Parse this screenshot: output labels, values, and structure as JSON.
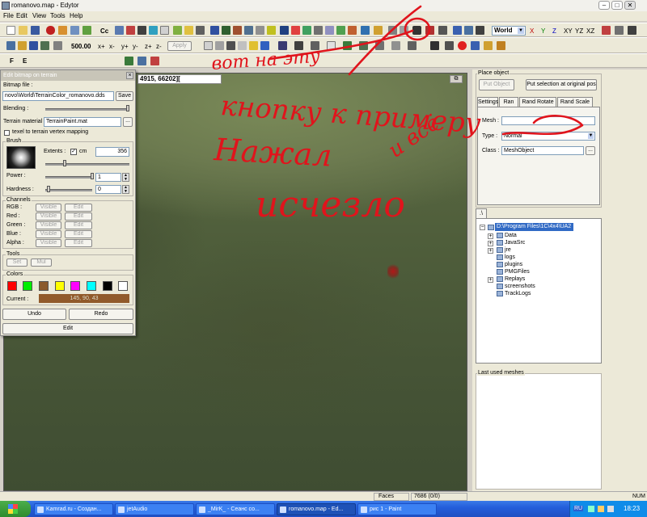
{
  "window": {
    "title": "romanovo.map - Edytor",
    "minimize": "–",
    "maximize": "□",
    "close": "✕"
  },
  "menu": [
    "File",
    "Edit",
    "View",
    "Tools",
    "Help"
  ],
  "toolbar1": {
    "cc_label": "Cc",
    "coord_system": "World",
    "axes": [
      "X",
      "Y",
      "Z",
      "XY",
      "YZ",
      "XZ"
    ]
  },
  "toolbar2": {
    "step_value": "500.00",
    "steps": [
      "x+",
      "x-",
      "y+",
      "y-",
      "z+",
      "z-"
    ],
    "apply_label": "Apply"
  },
  "toolbar3": {
    "f_label": "F",
    "e_label": "E"
  },
  "viewport": {
    "coords": "4915, 66202][",
    "corner_button": "⧉"
  },
  "dialog": {
    "title": "Edit bitmap on terrain",
    "bitmap_file_label": "Bitmap file :",
    "bitmap_file_value": "novo\\World\\TerrainColor_romanovo.dds",
    "save_label": "Save",
    "blending_label": "Blending :",
    "terrain_material_label": "Terrain material :",
    "terrain_material_value": "TerrainPaint.mat",
    "texel_label": "texel to terrain vertex mapping",
    "brush_label": "Brush",
    "extents_label": "Extents :",
    "cm_label": "cm",
    "extents_value": "356",
    "power_label": "Power :",
    "power_value": "1",
    "hardness_label": "Hardness :",
    "hardness_value": "0",
    "channels_label": "Channels",
    "channels": [
      {
        "name": "RGB :",
        "visible": "Visible",
        "edit": "Edit"
      },
      {
        "name": "Red :",
        "visible": "Visible",
        "edit": "Edit"
      },
      {
        "name": "Green :",
        "visible": "Visible",
        "edit": "Edit"
      },
      {
        "name": "Blue :",
        "visible": "Visible",
        "edit": "Edit"
      },
      {
        "name": "Alpha :",
        "visible": "Visible",
        "edit": "Edit"
      }
    ],
    "tools_label": "Tools",
    "set_label": "Set",
    "mul_label": "Mul",
    "colors_label": "Colors",
    "swatches": [
      "#ff0000",
      "#00ee00",
      "#8b5a2b",
      "#ffff00",
      "#ff00ff",
      "#00ffff",
      "#000000",
      "#ffffff"
    ],
    "current_label": "Current :",
    "current_value": "145, 90, 43",
    "current_color": "#915a2b",
    "undo_label": "Undo",
    "redo_label": "Redo",
    "edit_label": "Edit"
  },
  "place_object": {
    "group_label": "Place object",
    "put_object_label": "Put Object",
    "put_selection_label": "Put selection at original pos",
    "tabs": [
      "Settings",
      "Ran",
      "Rand Rotate",
      "Rand Scale"
    ],
    "mesh_label": "Mesh :",
    "type_label": "Type :",
    "type_value": "Normal",
    "class_label": "Class :",
    "class_value": "MeshObject"
  },
  "file_tree": {
    "path_tab": ".\\",
    "root": "D:\\Program Files\\1C\\4x4\\UA2",
    "items": [
      "Data",
      "JavaSrc",
      "jre",
      "logs",
      "plugins",
      "PMGFiles",
      "Replays",
      "screenshots",
      "TrackLogs"
    ]
  },
  "last_used": {
    "label": "Last used meshes"
  },
  "status": {
    "faces_label": "Faces",
    "faces_value": "7686 (0/0)",
    "num": "NUM"
  },
  "taskbar": {
    "tasks": [
      "Kamrad.ru - Создан...",
      "jetAudio",
      "_MirK_ - Сеанс со...",
      "romanovo.map - Ed...",
      "рис 1 - Paint"
    ],
    "lang": "RU",
    "time": "18:23"
  },
  "annotation": {
    "color": "#e0141c",
    "lines": [
      "вот на эту",
      "кнопку к примеру",
      "Нажал",
      "и всё",
      "исчезло"
    ]
  }
}
